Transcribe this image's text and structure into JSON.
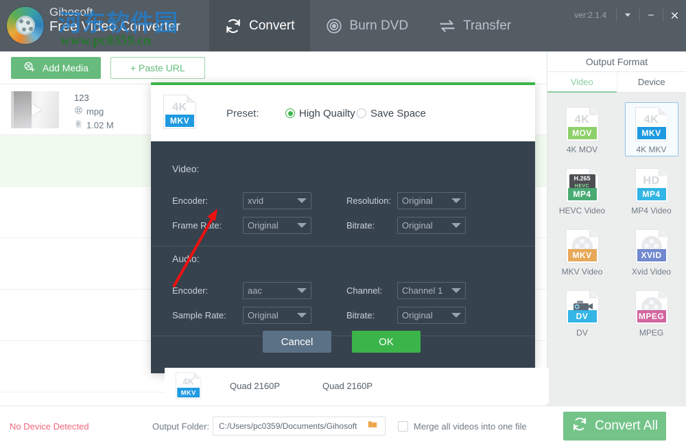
{
  "window": {
    "brand_line1": "Gihosoft",
    "brand_line2": "Free Video Converter",
    "watermark_cn": "河东软件园",
    "watermark_url": "www.pc0359.cn",
    "version": "ver:2.1.4",
    "controls": {
      "dropdown": "▾",
      "minimize": "—",
      "close": "✕"
    }
  },
  "nav": {
    "items": [
      {
        "label": "Convert",
        "icon": "refresh-icon",
        "active": true
      },
      {
        "label": "Burn DVD",
        "icon": "disc-icon",
        "active": false
      },
      {
        "label": "Transfer",
        "icon": "transfer-arrows-icon",
        "active": false
      }
    ]
  },
  "toolbar": {
    "add_media_label": "Add Media",
    "paste_url_label": "+ Paste URL"
  },
  "media_list": {
    "items": [
      {
        "name": "123",
        "format": "mpg",
        "size": "1.02 M"
      }
    ]
  },
  "sidebar": {
    "title": "Output Format",
    "tabs": [
      {
        "label": "Video",
        "active": true
      },
      {
        "label": "Device",
        "active": false
      }
    ],
    "formats": [
      {
        "label": "4K MOV",
        "big": "4K",
        "tag": "MOV",
        "tag_color": "#8ed06a",
        "art": "text",
        "selected": false
      },
      {
        "label": "4K MKV",
        "big": "4K",
        "tag": "MKV",
        "tag_color": "#1f9ae0",
        "art": "text",
        "selected": true
      },
      {
        "label": "HEVC Video",
        "big": "",
        "tag": "MP4",
        "tag_color": "#4aab73",
        "art": "hevc",
        "selected": false
      },
      {
        "label": "MP4 Video",
        "big": "HD",
        "tag": "MP4",
        "tag_color": "#33b5e5",
        "art": "text",
        "selected": false
      },
      {
        "label": "MKV Video",
        "big": "",
        "tag": "MKV",
        "tag_color": "#e8a85a",
        "art": "reel",
        "selected": false
      },
      {
        "label": "Xvid Video",
        "big": "",
        "tag": "XVID",
        "tag_color": "#7189cf",
        "art": "reel",
        "selected": false
      },
      {
        "label": "DV",
        "big": "",
        "tag": "DV",
        "tag_color": "#33b5e5",
        "art": "camera",
        "selected": false
      },
      {
        "label": "MPEG",
        "big": "",
        "tag": "MPEG",
        "tag_color": "#d濾",
        "art": "reel",
        "selected": false
      }
    ]
  },
  "bottom": {
    "device_status": "No Device Detected",
    "output_folder_label": "Output Folder:",
    "output_folder_value": "C:/Users/pc0359/Documents/Gihosoft",
    "browse_icon": "folder-icon",
    "merge_label": "Merge all videos into one file",
    "merge_checked": false,
    "convert_all_label": "Convert All"
  },
  "modal": {
    "file_badge": {
      "big": "4K",
      "tag": "MKV"
    },
    "preset_label": "Preset:",
    "preset_options": [
      {
        "label": "High Quailty",
        "selected": true
      },
      {
        "label": "Save Space",
        "selected": false
      }
    ],
    "video_section": {
      "title": "Video:",
      "fields": [
        {
          "label": "Encoder:",
          "value": "xvid"
        },
        {
          "label": "Resolution:",
          "value": "Original"
        },
        {
          "label": "Frame Rate:",
          "value": "Original"
        },
        {
          "label": "Bitrate:",
          "value": "Original"
        }
      ]
    },
    "audio_section": {
      "title": "Audio:",
      "fields": [
        {
          "label": "Encoder:",
          "value": "aac"
        },
        {
          "label": "Channel:",
          "value": "Channel 1"
        },
        {
          "label": "Sample Rate:",
          "value": "Original"
        },
        {
          "label": "Bitrate:",
          "value": "Original"
        }
      ]
    },
    "cancel_label": "Cancel",
    "ok_label": "OK"
  },
  "quad_row": {
    "badge_big": "4K",
    "badge_tag": "MKV",
    "col1": "Quad 2160P",
    "col2": "Quad 2160P"
  },
  "colors": {
    "titlebar": "#545c64",
    "accent_green": "#3bb54a",
    "button_green": "#74c48a",
    "modal_dark": "#36424d",
    "status_red": "#f2667a",
    "select_blue": "#8ec4e8"
  }
}
